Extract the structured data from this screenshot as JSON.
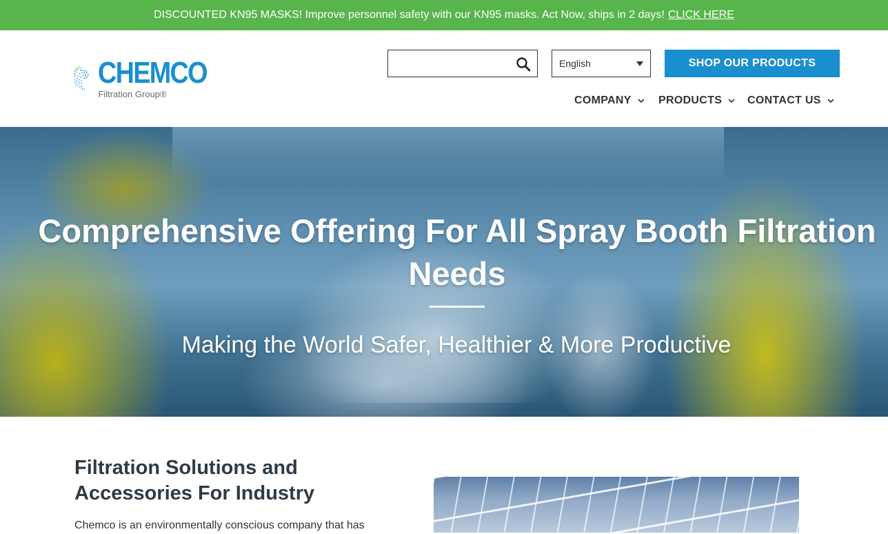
{
  "announcement": {
    "text": "DISCOUNTED KN95 MASKS! Improve personnel safety with our KN95 masks. Act Now, ships in 2 days!",
    "link_label": "CLICK HERE",
    "bg_color": "#57b54b"
  },
  "logo": {
    "name": "CHEMCO",
    "subtitle": "Filtration Group®",
    "icon": "chemco-dot-swirl-logo",
    "brand_color": "#1a8fd0"
  },
  "search": {
    "value": "",
    "placeholder": "",
    "icon": "search-icon"
  },
  "language": {
    "selected": "English"
  },
  "shop_button": {
    "label": "SHOP OUR PRODUCTS",
    "color": "#1a8fd0"
  },
  "nav": {
    "items": [
      {
        "label": "COMPANY",
        "icon": "chevron-down-icon"
      },
      {
        "label": "PRODUCTS",
        "icon": "chevron-down-icon"
      },
      {
        "label": "CONTACT US",
        "icon": "chevron-down-icon"
      }
    ]
  },
  "hero": {
    "title": "Comprehensive Offering For All Spray Booth Filtration Needs",
    "subtitle": "Making the World Safer, Healthier & More Productive"
  },
  "section": {
    "title": "Filtration Solutions and Accessories For Industry",
    "text": "Chemco is an environmentally conscious company that has"
  }
}
